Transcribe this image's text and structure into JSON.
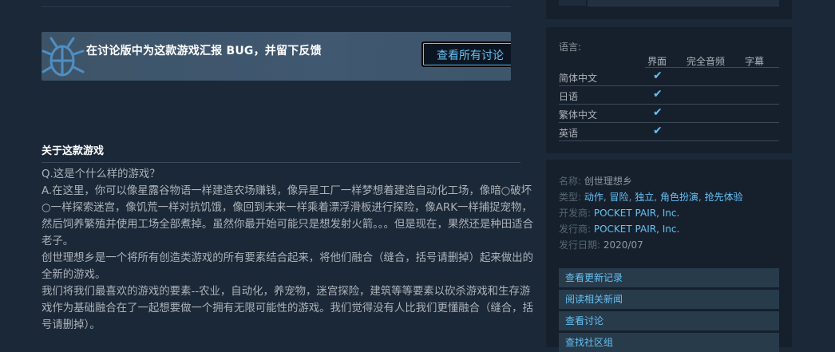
{
  "bug_banner": {
    "text": "在讨论版中为这款游戏汇报 BUG，并留下反馈",
    "button_label": "查看所有讨论"
  },
  "about": {
    "title": "关于这款游戏",
    "paragraphs": [
      "Q.这是个什么样的游戏？",
      "A.在这里，你可以像星露谷物语一样建造农场赚钱，像异星工厂一样梦想着建造自动化工场，像暗○破坏○一样探索迷宫，像饥荒一样对抗饥饿，像回到未来一样乘着漂浮滑板进行探险，像ARK一样捕捉宠物，然后饲养繁殖并使用工场全部煮掉。虽然你最开始可能只是想发射火箭。。。但是现在，果然还是种田适合老子。",
      "创世理想乡是一个将所有创造类游戏的所有要素结合起来，将他们融合（缝合，括号请删掉）起来做出的全新的游戏。",
      "我们将我们最喜欢的游戏的要素--农业，自动化，养宠物，迷宫探险，建筑等等要素以砍杀游戏和生存游戏作为基础融合在了一起想要做一个拥有无限可能性的游戏。我们觉得没有人比我们更懂融合（缝合，括号请删掉）。"
    ]
  },
  "languages": {
    "label": "语言:",
    "headers": [
      "界面",
      "完全音频",
      "字幕"
    ],
    "rows": [
      {
        "name": "简体中文",
        "check": "✔"
      },
      {
        "name": "日语",
        "check": "✔"
      },
      {
        "name": "繁体中文",
        "check": "✔"
      },
      {
        "name": "英语",
        "check": "✔"
      }
    ]
  },
  "details": {
    "name_label": "名称:",
    "name_value": "创世理想乡",
    "genre_label": "类型:",
    "genres": [
      "动作",
      "冒险",
      "独立",
      "角色扮演",
      "抢先体验"
    ],
    "developer_label": "开发商:",
    "developer": "POCKET PAIR, Inc.",
    "publisher_label": "发行商:",
    "publisher": "POCKET PAIR, Inc.",
    "release_label": "发行日期:",
    "release_date": "2020/07"
  },
  "links": [
    "查看更新记录",
    "阅读相关新闻",
    "查看讨论",
    "查找社区组"
  ],
  "colors": {
    "background": "#1b2838",
    "accent": "#66c0f4",
    "panel": "#16202d"
  }
}
